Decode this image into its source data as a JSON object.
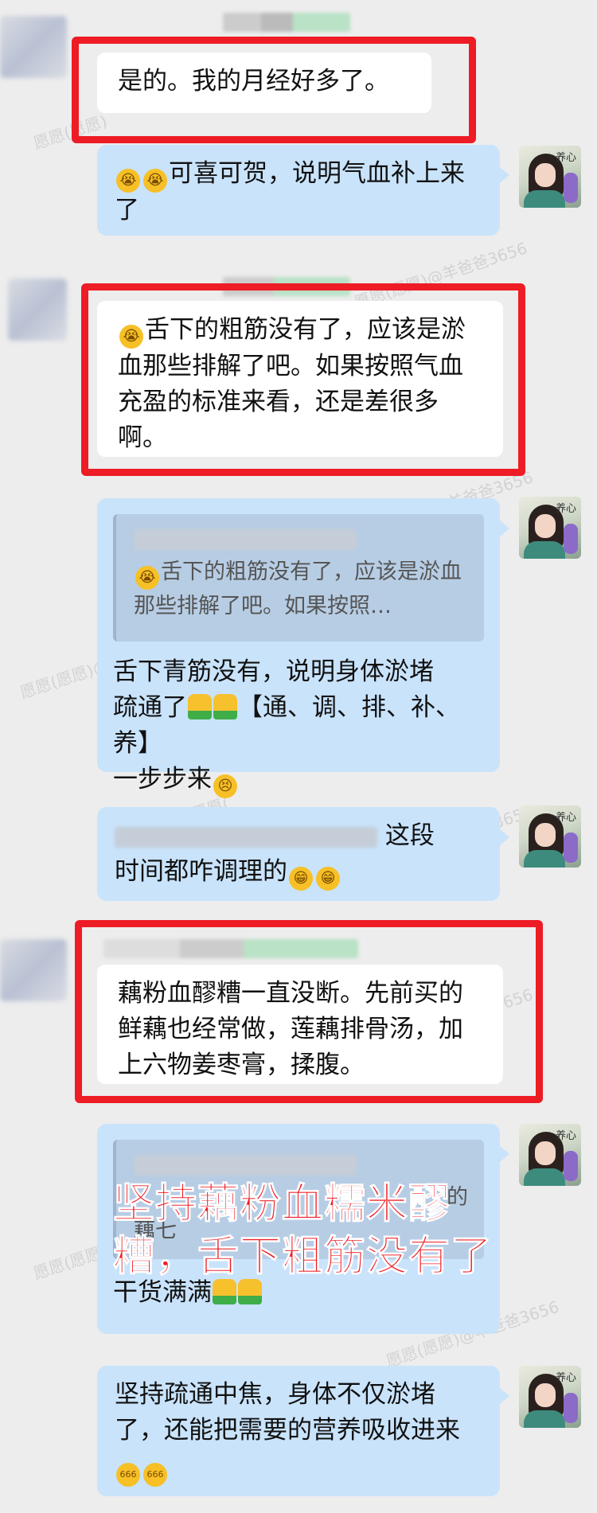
{
  "watermarks": [
    "愿愿(愿愿)",
    "愿愿(愿愿)@羊爸爸3656",
    "羊爸爸3656",
    "愿愿(愿愿)@羊爸爸3656",
    "羊爸爸3656",
    "愿愿(",
    "愿愿(愿愿)",
    "愿愿(愿愿)@羊爸爸3656",
    "羊爸爸3656"
  ],
  "avatar_glyph": "养心",
  "messages": {
    "m1": {
      "text": "是的。我的月经好多了。"
    },
    "m2": {
      "emoji": "😭😭",
      "text": "可喜可贺，说明气血补上来了"
    },
    "m3": {
      "emoji": "😭",
      "text": "舌下的粗筋没有了，应该是淤血那些排解了吧。如果按照气血充盈的标准来看，还是差很多啊。"
    },
    "m4": {
      "quote_emoji": "😭",
      "quote_text": "舌下的粗筋没有了，应该是淤血那些排解了吧。如果按照…",
      "text_line1": "舌下青筋没有，说明身体淤堵",
      "text_line2": "疏通了",
      "bracket": "【通、调、排、补、养】",
      "text_line3": "一步步来"
    },
    "m5": {
      "partial_top": "这段",
      "text": "时间都咋调理的"
    },
    "m6": {
      "text": "藕粉血醪糟一直没断。先前买的鲜藕也经常做，莲藕排骨汤，加上六物姜枣膏，揉腹。"
    },
    "m7": {
      "quote_fragment_1": "的",
      "quote_fragment_2": "藕七",
      "text": "干货满满"
    },
    "m8": {
      "text": "坚持疏通中焦，身体不仅淤堵了，还能把需要的营养吸收进来",
      "emoji_label": "666"
    }
  },
  "overlay_text": {
    "line1": "坚持藕粉血糯米醪",
    "line2": "糟，舌下粗筋没有了"
  },
  "colors": {
    "background": "#ededed",
    "own_bubble": "#c9e3fb",
    "other_bubble": "#ffffff",
    "highlight_border": "#ee1c25"
  }
}
